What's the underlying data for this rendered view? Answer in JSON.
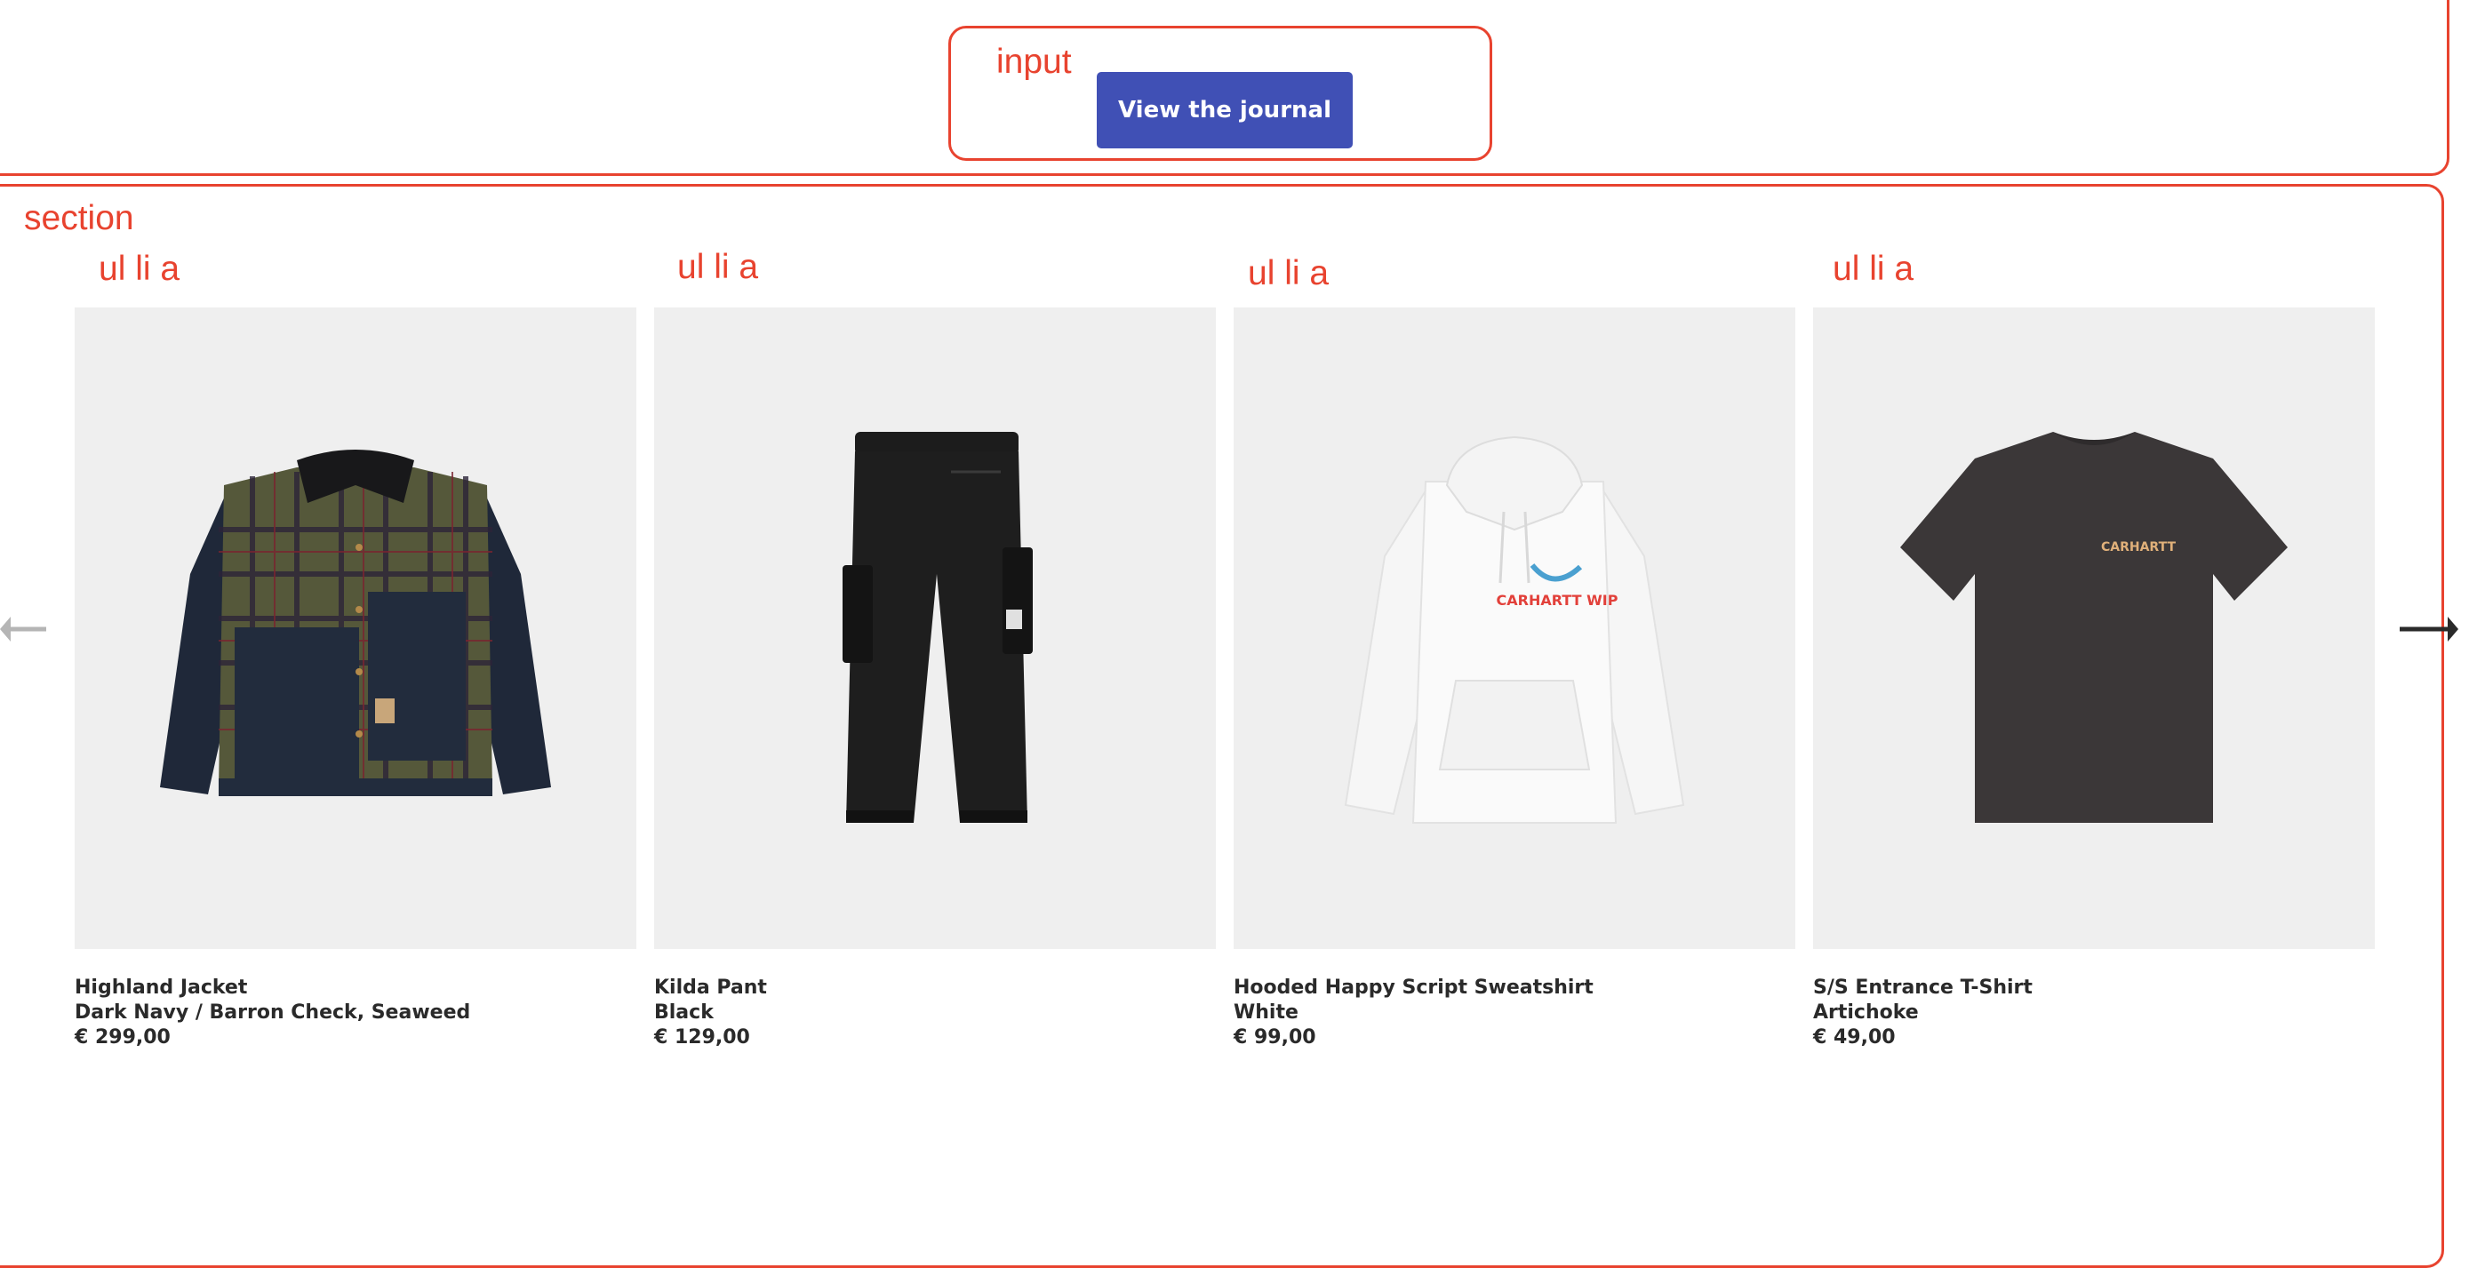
{
  "annotations": {
    "input_label": "input",
    "section_label": "section",
    "list_labels": [
      "ul li a",
      "ul li a",
      "ul li a",
      "ul li a"
    ]
  },
  "journal_button": {
    "label": "View the journal",
    "color": "#4050b5"
  },
  "annotation_color": "#e8432f",
  "products": [
    {
      "name": "Highland Jacket",
      "color": "Dark Navy / Barron Check, Seaweed",
      "price": "€ 299,00",
      "image_icon": "jacket-image"
    },
    {
      "name": "Kilda Pant",
      "color": "Black",
      "price": "€ 129,00",
      "image_icon": "pant-image"
    },
    {
      "name": "Hooded Happy Script Sweatshirt",
      "color": "White",
      "price": "€ 99,00",
      "image_icon": "hoodie-image",
      "graphic_text": "CARHARTT WIP"
    },
    {
      "name": "S/S Entrance T-Shirt",
      "color": "Artichoke",
      "price": "€ 49,00",
      "image_icon": "tshirt-image",
      "graphic_text": "CARHARTT"
    }
  ],
  "carousel": {
    "prev_icon": "arrow-left-icon",
    "next_icon": "arrow-right-icon"
  }
}
